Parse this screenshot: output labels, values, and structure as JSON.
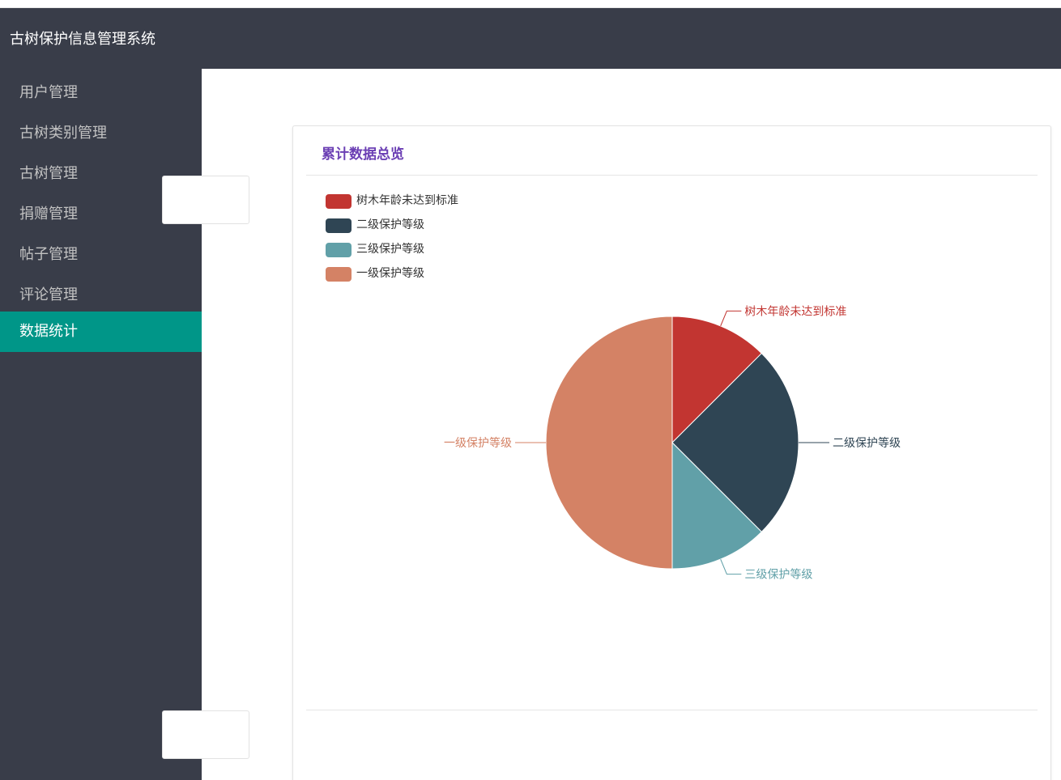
{
  "app": {
    "title": "古树保护信息管理系统"
  },
  "sidebar": {
    "items": [
      {
        "label": "用户管理",
        "active": false
      },
      {
        "label": "古树类别管理",
        "active": false
      },
      {
        "label": "古树管理",
        "active": false
      },
      {
        "label": "捐赠管理",
        "active": false
      },
      {
        "label": "帖子管理",
        "active": false
      },
      {
        "label": "评论管理",
        "active": false
      },
      {
        "label": "数据统计",
        "active": true
      }
    ]
  },
  "panel": {
    "title": "累计数据总览"
  },
  "colors": {
    "header_bg": "#393d49",
    "active_nav": "#009688",
    "title_accent": "#6b3fb4"
  },
  "chart_data": {
    "type": "pie",
    "legend_position": "top-left",
    "slices": [
      {
        "name": "树木年龄未达到标准",
        "value": 1,
        "color": "#c23531"
      },
      {
        "name": "二级保护等级",
        "value": 2,
        "color": "#2f4554"
      },
      {
        "name": "三级保护等级",
        "value": 1,
        "color": "#61a0a8"
      },
      {
        "name": "一级保护等级",
        "value": 4,
        "color": "#d48265"
      }
    ]
  }
}
